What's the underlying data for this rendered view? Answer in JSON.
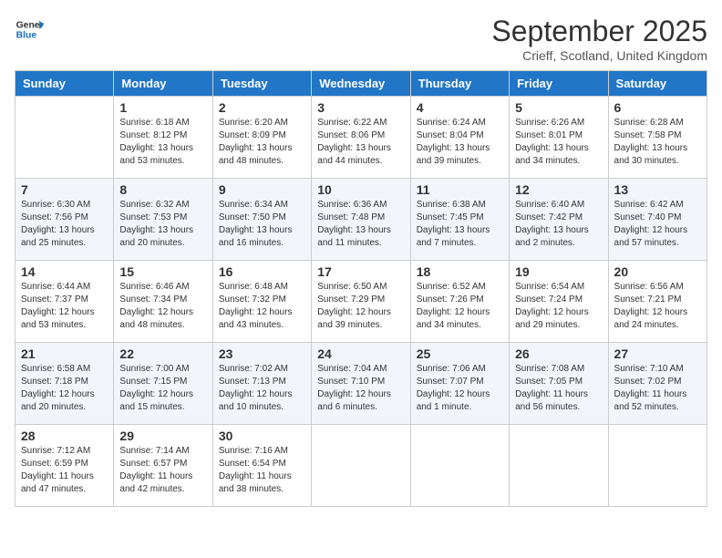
{
  "header": {
    "logo_line1": "General",
    "logo_line2": "Blue",
    "month": "September 2025",
    "location": "Crieff, Scotland, United Kingdom"
  },
  "days_of_week": [
    "Sunday",
    "Monday",
    "Tuesday",
    "Wednesday",
    "Thursday",
    "Friday",
    "Saturday"
  ],
  "weeks": [
    [
      {
        "day": "",
        "content": ""
      },
      {
        "day": "1",
        "content": "Sunrise: 6:18 AM\nSunset: 8:12 PM\nDaylight: 13 hours\nand 53 minutes."
      },
      {
        "day": "2",
        "content": "Sunrise: 6:20 AM\nSunset: 8:09 PM\nDaylight: 13 hours\nand 48 minutes."
      },
      {
        "day": "3",
        "content": "Sunrise: 6:22 AM\nSunset: 8:06 PM\nDaylight: 13 hours\nand 44 minutes."
      },
      {
        "day": "4",
        "content": "Sunrise: 6:24 AM\nSunset: 8:04 PM\nDaylight: 13 hours\nand 39 minutes."
      },
      {
        "day": "5",
        "content": "Sunrise: 6:26 AM\nSunset: 8:01 PM\nDaylight: 13 hours\nand 34 minutes."
      },
      {
        "day": "6",
        "content": "Sunrise: 6:28 AM\nSunset: 7:58 PM\nDaylight: 13 hours\nand 30 minutes."
      }
    ],
    [
      {
        "day": "7",
        "content": "Sunrise: 6:30 AM\nSunset: 7:56 PM\nDaylight: 13 hours\nand 25 minutes."
      },
      {
        "day": "8",
        "content": "Sunrise: 6:32 AM\nSunset: 7:53 PM\nDaylight: 13 hours\nand 20 minutes."
      },
      {
        "day": "9",
        "content": "Sunrise: 6:34 AM\nSunset: 7:50 PM\nDaylight: 13 hours\nand 16 minutes."
      },
      {
        "day": "10",
        "content": "Sunrise: 6:36 AM\nSunset: 7:48 PM\nDaylight: 13 hours\nand 11 minutes."
      },
      {
        "day": "11",
        "content": "Sunrise: 6:38 AM\nSunset: 7:45 PM\nDaylight: 13 hours\nand 7 minutes."
      },
      {
        "day": "12",
        "content": "Sunrise: 6:40 AM\nSunset: 7:42 PM\nDaylight: 13 hours\nand 2 minutes."
      },
      {
        "day": "13",
        "content": "Sunrise: 6:42 AM\nSunset: 7:40 PM\nDaylight: 12 hours\nand 57 minutes."
      }
    ],
    [
      {
        "day": "14",
        "content": "Sunrise: 6:44 AM\nSunset: 7:37 PM\nDaylight: 12 hours\nand 53 minutes."
      },
      {
        "day": "15",
        "content": "Sunrise: 6:46 AM\nSunset: 7:34 PM\nDaylight: 12 hours\nand 48 minutes."
      },
      {
        "day": "16",
        "content": "Sunrise: 6:48 AM\nSunset: 7:32 PM\nDaylight: 12 hours\nand 43 minutes."
      },
      {
        "day": "17",
        "content": "Sunrise: 6:50 AM\nSunset: 7:29 PM\nDaylight: 12 hours\nand 39 minutes."
      },
      {
        "day": "18",
        "content": "Sunrise: 6:52 AM\nSunset: 7:26 PM\nDaylight: 12 hours\nand 34 minutes."
      },
      {
        "day": "19",
        "content": "Sunrise: 6:54 AM\nSunset: 7:24 PM\nDaylight: 12 hours\nand 29 minutes."
      },
      {
        "day": "20",
        "content": "Sunrise: 6:56 AM\nSunset: 7:21 PM\nDaylight: 12 hours\nand 24 minutes."
      }
    ],
    [
      {
        "day": "21",
        "content": "Sunrise: 6:58 AM\nSunset: 7:18 PM\nDaylight: 12 hours\nand 20 minutes."
      },
      {
        "day": "22",
        "content": "Sunrise: 7:00 AM\nSunset: 7:15 PM\nDaylight: 12 hours\nand 15 minutes."
      },
      {
        "day": "23",
        "content": "Sunrise: 7:02 AM\nSunset: 7:13 PM\nDaylight: 12 hours\nand 10 minutes."
      },
      {
        "day": "24",
        "content": "Sunrise: 7:04 AM\nSunset: 7:10 PM\nDaylight: 12 hours\nand 6 minutes."
      },
      {
        "day": "25",
        "content": "Sunrise: 7:06 AM\nSunset: 7:07 PM\nDaylight: 12 hours\nand 1 minute."
      },
      {
        "day": "26",
        "content": "Sunrise: 7:08 AM\nSunset: 7:05 PM\nDaylight: 11 hours\nand 56 minutes."
      },
      {
        "day": "27",
        "content": "Sunrise: 7:10 AM\nSunset: 7:02 PM\nDaylight: 11 hours\nand 52 minutes."
      }
    ],
    [
      {
        "day": "28",
        "content": "Sunrise: 7:12 AM\nSunset: 6:59 PM\nDaylight: 11 hours\nand 47 minutes."
      },
      {
        "day": "29",
        "content": "Sunrise: 7:14 AM\nSunset: 6:57 PM\nDaylight: 11 hours\nand 42 minutes."
      },
      {
        "day": "30",
        "content": "Sunrise: 7:16 AM\nSunset: 6:54 PM\nDaylight: 11 hours\nand 38 minutes."
      },
      {
        "day": "",
        "content": ""
      },
      {
        "day": "",
        "content": ""
      },
      {
        "day": "",
        "content": ""
      },
      {
        "day": "",
        "content": ""
      }
    ]
  ]
}
